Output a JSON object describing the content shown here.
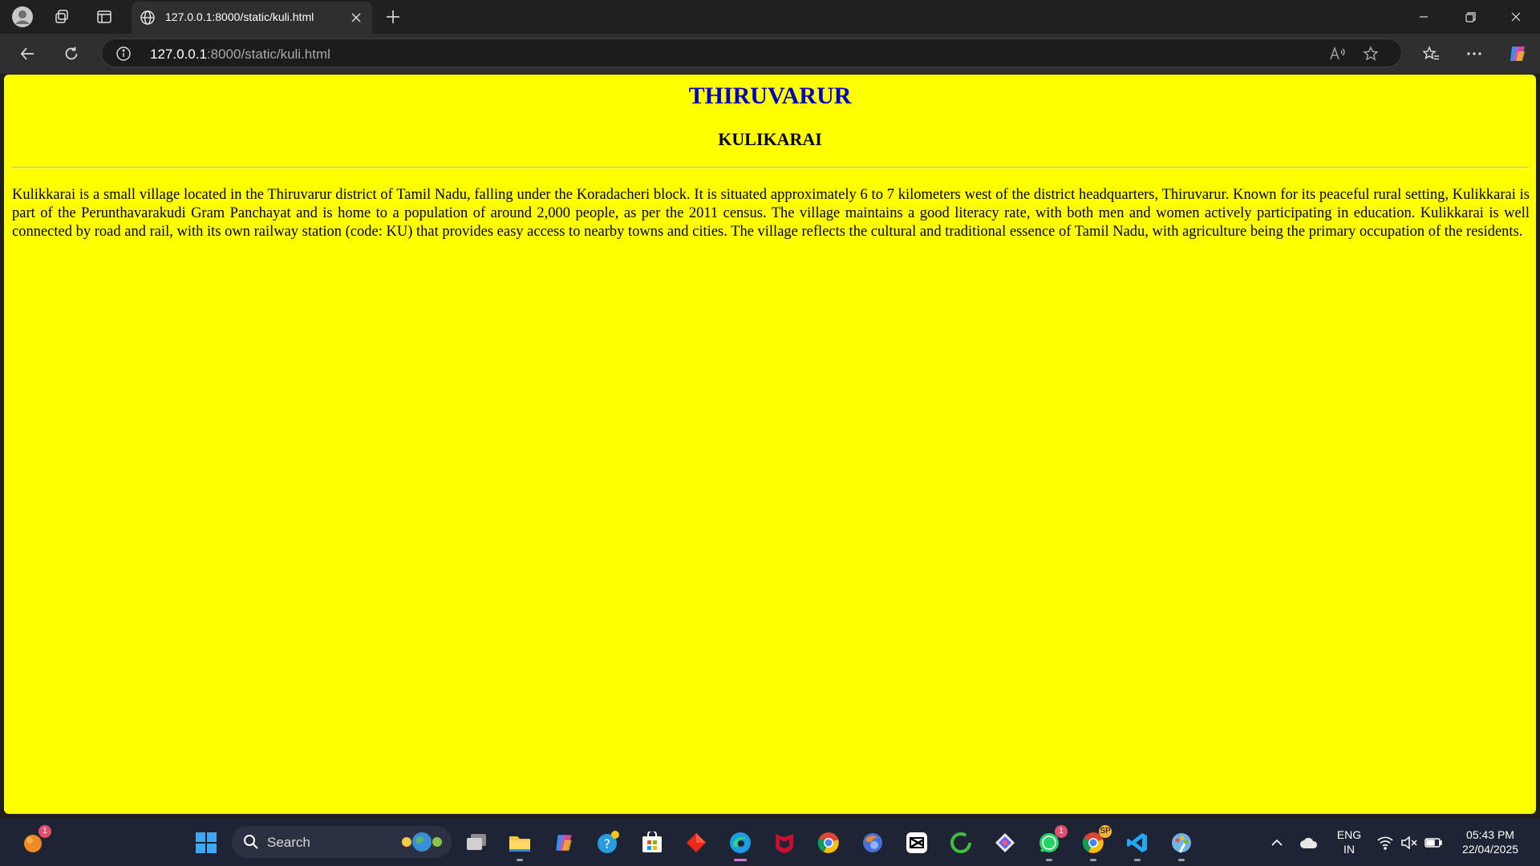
{
  "browser": {
    "tab": {
      "title": "127.0.0.1:8000/static/kuli.html"
    },
    "url": {
      "host": "127.0.0.1",
      "path": ":8000/static/kuli.html"
    }
  },
  "page": {
    "heading": "THIRUVARUR",
    "subheading": "KULIKARAI",
    "paragraph": "Kulikkarai is a small village located in the Thiruvarur district of Tamil Nadu, falling under the Koradacheri block. It is situated approximately 6 to 7 kilometers west of the district headquarters, Thiruvarur. Known for its peaceful rural setting, Kulikkarai is part of the Perunthavarakudi Gram Panchayat and is home to a population of around 2,000 people, as per the 2011 census. The village maintains a good literacy rate, with both men and women actively participating in education. Kulikkarai is well connected by road and rail, with its own railway station (code: KU) that provides easy access to nearby towns and cities. The village reflects the cultural and traditional essence of Tamil Nadu, with agriculture being the primary occupation of the residents.",
    "background_color": "#ffff00",
    "heading_color": "#0000cc"
  },
  "taskbar": {
    "search_label": "Search",
    "notification_badge": "1",
    "whatsapp_badge": "1",
    "chrome_badge": "SP",
    "language_line1": "ENG",
    "language_line2": "IN",
    "time": "05:43 PM",
    "date": "22/04/2025"
  }
}
